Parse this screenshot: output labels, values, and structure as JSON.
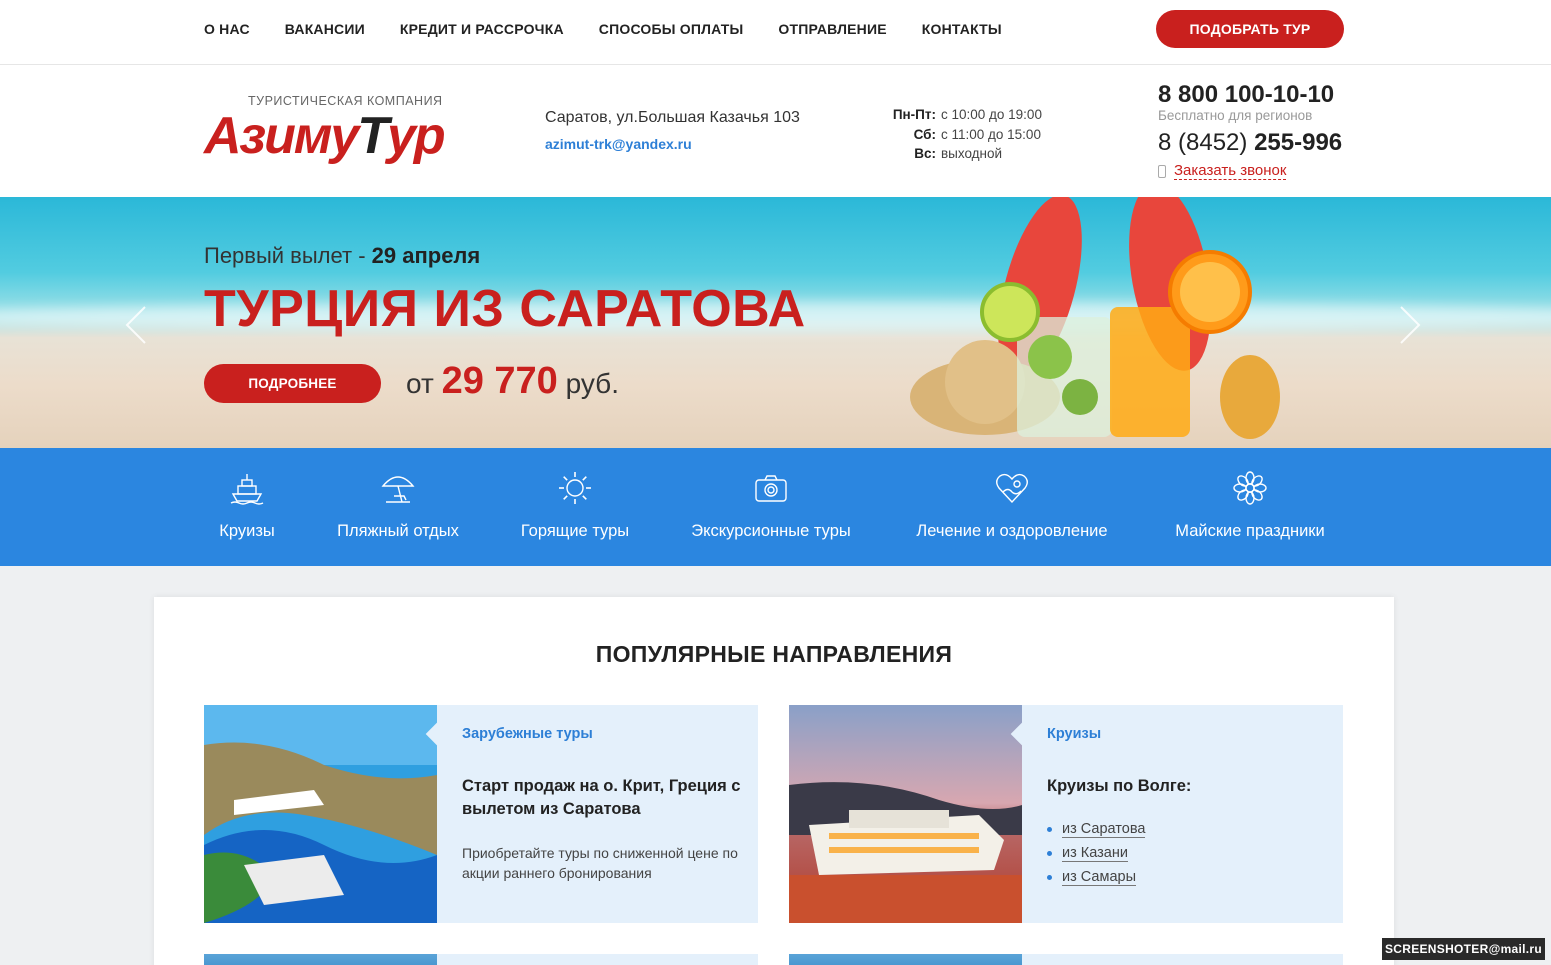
{
  "nav": {
    "items": [
      "О НАС",
      "ВАКАНСИИ",
      "КРЕДИТ И РАССРОЧКА",
      "СПОСОБЫ ОПЛАТЫ",
      "ОТПРАВЛЕНИЕ",
      "КОНТАКТЫ"
    ],
    "cta_label": "ПОДОБРАТЬ ТУР"
  },
  "header": {
    "logo_tagline": "ТУРИСТИЧЕСКАЯ КОМПАНИЯ",
    "logo_part1": "Азиму",
    "logo_part2": "Т",
    "logo_part3": "ур",
    "address": "Саратов, ул.Большая Казачья 103",
    "email": "azimut-trk@yandex.ru",
    "hours": [
      {
        "day": "Пн-Пт:",
        "time": "с 10:00 до 19:00"
      },
      {
        "day": "Сб:",
        "time": "с 11:00 до 15:00"
      },
      {
        "day": "Вс:",
        "time": "выходной"
      }
    ],
    "phone_free": "8 800 100-10-10",
    "phone_free_note": "Бесплатно для регионов",
    "phone_local_prefix": "8 (8452)",
    "phone_local_number": "255-996",
    "callback_label": "Заказать звонок"
  },
  "hero": {
    "subtitle_prefix": "Первый вылет - ",
    "subtitle_date": "29 апреля",
    "title": "ТУРЦИЯ ИЗ САРАТОВА",
    "button_label": "ПОДРОБНЕЕ",
    "price_prefix": "от",
    "price_value": "29 770",
    "price_suffix": "руб."
  },
  "categories": [
    {
      "label": "Круизы",
      "icon": "ship-icon"
    },
    {
      "label": "Пляжный отдых",
      "icon": "beach-umbrella-icon"
    },
    {
      "label": "Горящие туры",
      "icon": "sun-icon"
    },
    {
      "label": "Экскурсионные туры",
      "icon": "camera-icon"
    },
    {
      "label": "Лечение и оздоровление",
      "icon": "heart-icon"
    },
    {
      "label": "Майские праздники",
      "icon": "flower-icon"
    }
  ],
  "popular": {
    "heading": "ПОПУЛЯРНЫЕ НАПРАВЛЕНИЯ",
    "tiles": [
      {
        "category": "Зарубежные туры",
        "title": "Старт продаж на о. Крит, Греция с вылетом из Саратова",
        "text": "Приобретайте туры по сниженной цене по акции раннего бронирования"
      },
      {
        "category": "Круизы",
        "title": "Круизы по Волге:",
        "links": [
          "из Саратова",
          "из Казани",
          "из Самары"
        ]
      }
    ]
  },
  "watermark": "SCREENSHOTER@mail.ru",
  "colors": {
    "accent_red": "#c9201e",
    "accent_blue": "#2b86e0",
    "link_blue": "#2d7fd6"
  }
}
